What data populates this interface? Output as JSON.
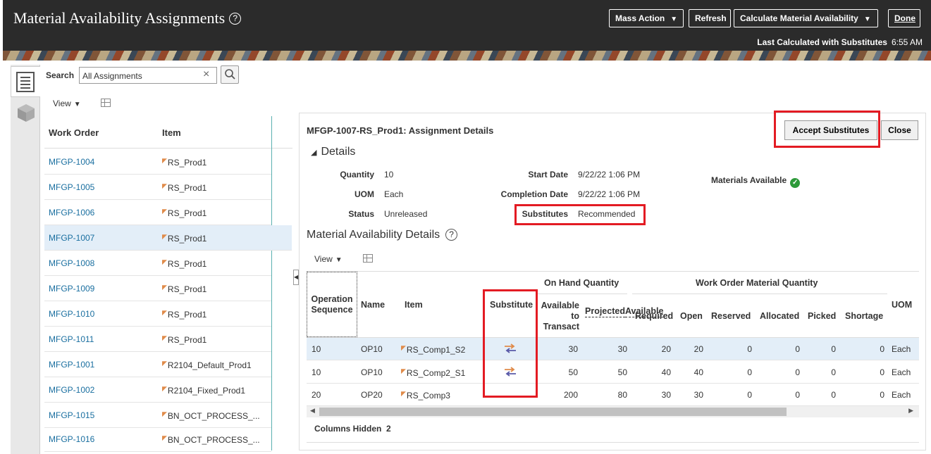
{
  "header": {
    "title": "Material Availability Assignments",
    "help_glyph": "?",
    "mass_action": "Mass Action",
    "refresh": "Refresh",
    "calculate": "Calculate Material Availability",
    "done": "Done",
    "last_calc_label": "Last Calculated with Substitutes",
    "last_calc_time": "6:55 AM"
  },
  "search": {
    "label": "Search",
    "value": "All Assignments",
    "clear_glyph": "×"
  },
  "list": {
    "view_label": "View",
    "col_work_order": "Work Order",
    "col_item": "Item",
    "rows": [
      {
        "wo": "MFGP-1004",
        "item": "RS_Prod1"
      },
      {
        "wo": "MFGP-1005",
        "item": "RS_Prod1"
      },
      {
        "wo": "MFGP-1006",
        "item": "RS_Prod1"
      },
      {
        "wo": "MFGP-1007",
        "item": "RS_Prod1"
      },
      {
        "wo": "MFGP-1008",
        "item": "RS_Prod1"
      },
      {
        "wo": "MFGP-1009",
        "item": "RS_Prod1"
      },
      {
        "wo": "MFGP-1010",
        "item": "RS_Prod1"
      },
      {
        "wo": "MFGP-1011",
        "item": "RS_Prod1"
      },
      {
        "wo": "MFGP-1001",
        "item": "R2104_Default_Prod1"
      },
      {
        "wo": "MFGP-1002",
        "item": "R2104_Fixed_Prod1"
      },
      {
        "wo": "MFGP-1015",
        "item": "BN_OCT_PROCESS_..."
      },
      {
        "wo": "MFGP-1016",
        "item": "BN_OCT_PROCESS_..."
      }
    ]
  },
  "panel": {
    "title": "MFGP-1007-RS_Prod1: Assignment Details",
    "accept_substitutes": "Accept Substitutes",
    "close": "Close",
    "details_title": "Details",
    "quantity_label": "Quantity",
    "quantity": "10",
    "uom_label": "UOM",
    "uom": "Each",
    "status_label": "Status",
    "status": "Unreleased",
    "start_date_label": "Start Date",
    "start_date": "9/22/22 1:06 PM",
    "completion_date_label": "Completion Date",
    "completion_date": "9/22/22 1:06 PM",
    "substitutes_label": "Substitutes",
    "substitutes": "Recommended",
    "materials_available": "Materials Available",
    "mad_title": "Material Availability Details",
    "view_label": "View"
  },
  "table": {
    "group_on_hand": "On Hand Quantity",
    "group_wo_material": "Work Order Material Quantity",
    "h_op_seq_1": "Operation",
    "h_op_seq_2": "Sequence",
    "h_name": "Name",
    "h_item": "Item",
    "h_substitute": "Substitute",
    "h_avail_1": "Available",
    "h_avail_2": "to",
    "h_avail_3": "Transact",
    "h_proj_1": "Projected",
    "h_proj_2": "Available",
    "h_required": "Required",
    "h_open": "Open",
    "h_reserved": "Reserved",
    "h_allocated": "Allocated",
    "h_picked": "Picked",
    "h_shortage": "Shortage",
    "h_uom": "UOM",
    "rows": [
      {
        "seq": "10",
        "name": "OP10",
        "item": "RS_Comp1_S2",
        "avail": "30",
        "proj": "30",
        "req": "20",
        "open": "20",
        "res": "0",
        "alloc": "0",
        "picked": "0",
        "short": "0",
        "uom": "Each"
      },
      {
        "seq": "10",
        "name": "OP10",
        "item": "RS_Comp2_S1",
        "avail": "50",
        "proj": "50",
        "req": "40",
        "open": "40",
        "res": "0",
        "alloc": "0",
        "picked": "0",
        "short": "0",
        "uom": "Each"
      },
      {
        "seq": "20",
        "name": "OP20",
        "item": "RS_Comp3",
        "avail": "200",
        "proj": "80",
        "req": "30",
        "open": "30",
        "res": "0",
        "alloc": "0",
        "picked": "0",
        "short": "0",
        "uom": "Each"
      }
    ],
    "columns_hidden_label": "Columns Hidden",
    "columns_hidden": "2"
  }
}
